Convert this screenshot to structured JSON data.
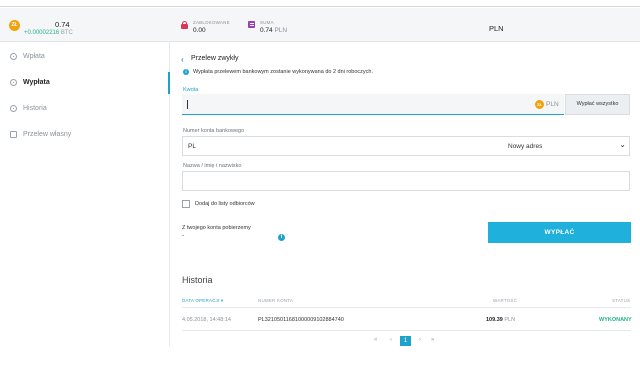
{
  "header": {
    "balance": "0.74",
    "coin_label": "ZŁ",
    "balance_change_value": "+0.00002216",
    "balance_change_unit": "BTC",
    "blocked_label": "ZABLOKOWANE",
    "blocked_value": "0.00",
    "sum_label": "SUMA",
    "sum_value": "0.74",
    "sum_currency": "PLN",
    "currency": "PLN"
  },
  "sidebar": {
    "items": [
      {
        "label": "Wpłata",
        "icon": "deposit-icon",
        "active": false
      },
      {
        "label": "Wypłata",
        "icon": "withdraw-icon",
        "active": true
      },
      {
        "label": "Historia",
        "icon": "clock-icon",
        "active": false
      },
      {
        "label": "Przelew własny",
        "icon": "transfer-icon",
        "active": false
      }
    ]
  },
  "main": {
    "title": "Przelew zwykły",
    "info": "Wypłata przelewem bankowym zostanie wykonywana do 2 dni roboczych.",
    "amount_label": "Kwota",
    "amount_value": "",
    "amount_coin": "ZŁ",
    "amount_currency": "PLN",
    "withdraw_all": "Wypłać wszystko",
    "account_label": "Numer konta bankowego",
    "account_value": "PL",
    "account_option": "Nowy adres",
    "name_label": "Nazwa / imię i nazwisko",
    "name_value": "",
    "add_to_list": "Dodaj do listy odbiorców",
    "from_account_label": "Z twojego konta pobierzemy",
    "from_account_value": "-",
    "submit": "WYPŁAĆ"
  },
  "history": {
    "title": "Historia",
    "columns": [
      "DATA OPERACJI",
      "NUMER KONTA",
      "WARTOŚĆ",
      "STATUS"
    ],
    "rows": [
      {
        "date": "4.05.2018, 14:48:14",
        "account": "PL32105011681000009102884740",
        "amount": "109.39",
        "currency": "PLN",
        "status": "WYKONANY"
      }
    ],
    "pager": {
      "first": "«",
      "prev": "‹",
      "current": "1",
      "next": "›",
      "last": "»"
    }
  },
  "colors": {
    "accent": "#1fa2c9",
    "button": "#1fb0dc",
    "success": "#1fb38a",
    "coin": "#f0a30a",
    "blocked": "#e0345a",
    "sum": "#9b3fb5"
  }
}
